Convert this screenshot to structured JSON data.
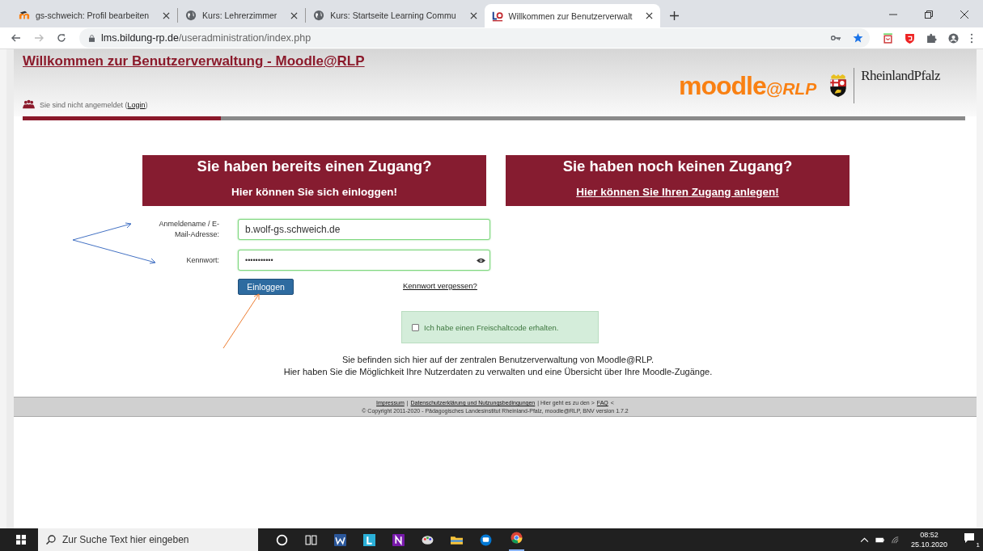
{
  "browser": {
    "tabs": [
      {
        "title": "gs-schweich: Profil bearbeiten",
        "kind": "moodle",
        "selected": false
      },
      {
        "title": "Kurs: Lehrerzimmer",
        "kind": "globe",
        "selected": false
      },
      {
        "title": "Kurs: Startseite Learning Commu",
        "kind": "globe",
        "selected": false
      },
      {
        "title": "Willkommen zur Benutzerverwalt",
        "kind": "lo",
        "selected": true
      }
    ],
    "url": {
      "host": "lms.bildung-rp.de",
      "path": "/useradministration/index.php"
    }
  },
  "header": {
    "title": "Willkommen zur Benutzerverwaltung - Moodle@RLP",
    "status": "Sie sind nicht angemeldet (",
    "status_link": "Login",
    "status_end": ")",
    "logo_main": "moodle",
    "logo_suffix": "@RLP",
    "state_name": "RheinlandPfalz",
    "progress": {
      "level": 0.21
    }
  },
  "panels": [
    {
      "heading": "Sie haben bereits einen Zugang?",
      "subheading": "Hier können Sie sich einloggen!",
      "link": false
    },
    {
      "heading": "Sie haben noch keinen Zugang?",
      "subheading": "Hier können Sie Ihren Zugang anlegen!",
      "link": true
    }
  ],
  "form": {
    "fields": [
      {
        "label": "Anmeldename / E-Mail-Adresse:",
        "value": "b.wolf-gs.schweich.de",
        "kind": "text"
      },
      {
        "label": "Kennwort:",
        "value": "•••••••••••",
        "kind": "password"
      }
    ],
    "submit": "Einloggen",
    "forgot": "Kennwort vergessen?",
    "code_checkbox": {
      "label": "Ich habe einen Freischaltcode erhalten.",
      "checked": false
    }
  },
  "info": [
    "Sie befinden sich hier auf der zentralen Benutzerverwaltung von Moodle@RLP.",
    "Hier haben Sie die Möglichkeit Ihre Nutzerdaten zu verwalten und eine Übersicht über Ihre Moodle-Zugänge."
  ],
  "footer": {
    "line": [
      {
        "kind": "link",
        "text": "Impressum"
      },
      {
        "kind": "text",
        "text": "|"
      },
      {
        "kind": "link",
        "text": "Datenschutzerklärung und Nutzungsbedingungen"
      },
      {
        "kind": "text",
        "text": "| Hier geht es zu den >"
      },
      {
        "kind": "link",
        "text": "FAQ"
      },
      {
        "kind": "text",
        "text": "<"
      }
    ],
    "copyright": "© Copyright 2011-2020 - Pädagogisches Landesinstitut Rheinland-Pfalz, moodle@RLP, BNV version 1.7.2"
  },
  "taskbar": {
    "search_placeholder": "Zur Suche Text hier eingeben",
    "time": "08:52",
    "date": "25.10.2020",
    "notifications": "1"
  }
}
